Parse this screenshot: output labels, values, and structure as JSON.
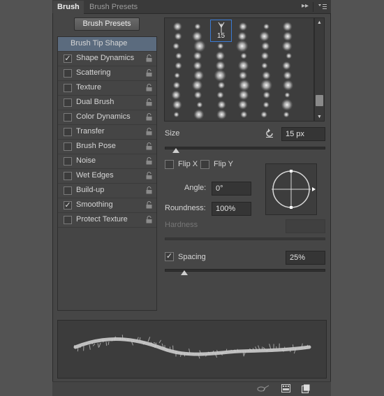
{
  "tabs": [
    {
      "label": "Brush"
    },
    {
      "label": "Brush Presets"
    }
  ],
  "presets_button": "Brush Presets",
  "sections": {
    "tip_shape": "Brush Tip Shape",
    "items": [
      {
        "label": "Shape Dynamics",
        "checked": true
      },
      {
        "label": "Scattering",
        "checked": false
      },
      {
        "label": "Texture",
        "checked": false
      },
      {
        "label": "Dual Brush",
        "checked": false
      },
      {
        "label": "Color Dynamics",
        "checked": false
      },
      {
        "label": "Transfer",
        "checked": false
      },
      {
        "label": "Brush Pose",
        "checked": false
      },
      {
        "label": "Noise",
        "checked": false
      },
      {
        "label": "Wet Edges",
        "checked": false
      },
      {
        "label": "Build-up",
        "checked": false
      },
      {
        "label": "Smoothing",
        "checked": true
      },
      {
        "label": "Protect Texture",
        "checked": false
      }
    ]
  },
  "brush_grid": {
    "selected_size_label": "15"
  },
  "size": {
    "label": "Size",
    "value": "15 px",
    "slider_fraction": 0.07
  },
  "flip": {
    "x_label": "Flip X",
    "y_label": "Flip Y",
    "x_checked": false,
    "y_checked": false
  },
  "angle": {
    "label": "Angle:",
    "value": "0°"
  },
  "roundness": {
    "label": "Roundness:",
    "value": "100%"
  },
  "hardness": {
    "label": "Hardness",
    "value": ""
  },
  "spacing": {
    "label": "Spacing",
    "checked": true,
    "value": "25%",
    "slider_fraction": 0.12
  },
  "icons": {
    "panel_menu": "menu-icon",
    "collapse": "double-arrow-icon",
    "reset": "reset-icon",
    "lock": "lock-icon",
    "footer": [
      "toggle-preview-icon",
      "brush-grid-icon",
      "new-preset-icon"
    ]
  },
  "colors": {
    "selected": "#5b6b7e",
    "panel": "#464646",
    "accent_border": "#3a7bd5"
  }
}
